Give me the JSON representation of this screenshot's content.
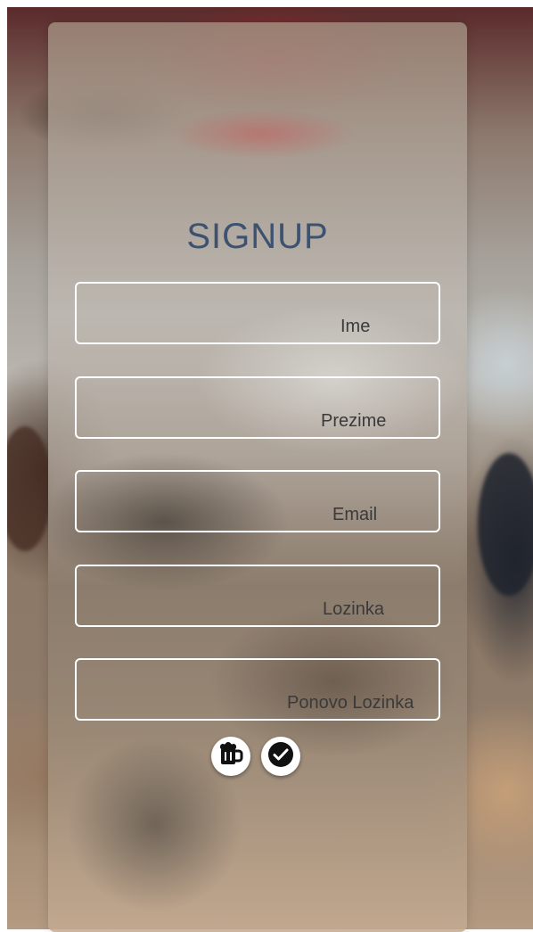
{
  "signup": {
    "title": "SIGNUP",
    "fields": [
      {
        "placeholder": "Ime",
        "value": ""
      },
      {
        "placeholder": "Prezime",
        "value": ""
      },
      {
        "placeholder": "Email",
        "value": ""
      },
      {
        "placeholder": "Lozinka",
        "value": ""
      },
      {
        "placeholder": "Ponovo Lozinka",
        "value": ""
      }
    ],
    "actions": [
      {
        "icon": "beer-mug-icon"
      },
      {
        "icon": "check-circle-icon"
      }
    ]
  },
  "colors": {
    "title": "#3c5270",
    "field_border": "#ffffff",
    "placeholder": "#3a3a3a"
  }
}
